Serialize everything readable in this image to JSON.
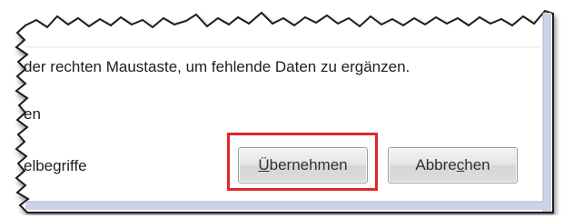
{
  "dialog": {
    "lines": [
      "der rechten Maustaste, um fehlende Daten zu ergänzen.",
      "en",
      "elbegriffe"
    ],
    "buttons": {
      "apply_label": "Übernehmen",
      "apply_mnemonic": "Ü",
      "apply_rest": "bernehmen",
      "cancel_prefix": "Abbre",
      "cancel_mnemonic": "c",
      "cancel_suffix": "hen",
      "cancel_label": "Abbrechen"
    }
  },
  "colors": {
    "highlight": "#e2262a",
    "window_edge": "#bcc8dc",
    "button_border": "#9c9c9c"
  }
}
